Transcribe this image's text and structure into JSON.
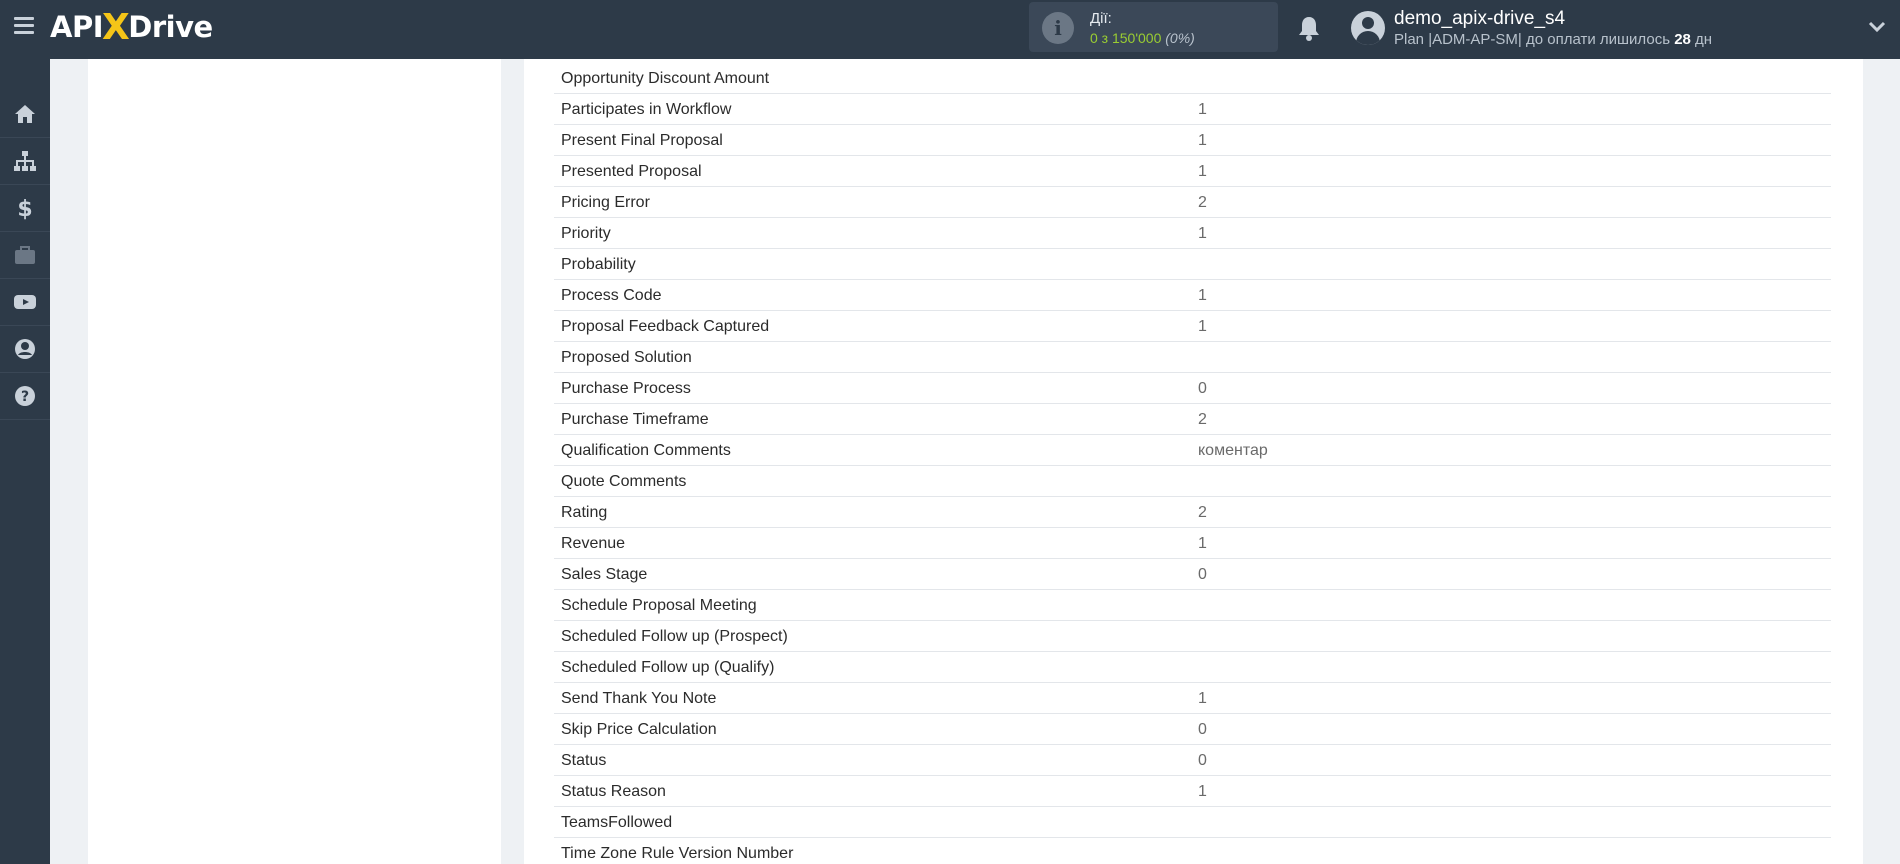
{
  "header": {
    "logo": {
      "api": "API",
      "x": "X",
      "drive": "Drive"
    },
    "stats": {
      "label": "Дії:",
      "value": "0 з 150'000",
      "percent": "(0%)"
    },
    "user": {
      "name": "demo_apix-drive_s4",
      "plan_prefix": "Plan |ADM-AP-SM| до оплати лишилось ",
      "days": "28",
      "days_suffix": " дн"
    }
  },
  "sidebar": {
    "items": [
      {
        "name": "home",
        "icon": "home-icon"
      },
      {
        "name": "connections",
        "icon": "sitemap-icon"
      },
      {
        "name": "billing",
        "icon": "dollar-icon"
      },
      {
        "name": "services",
        "icon": "briefcase-icon"
      },
      {
        "name": "video",
        "icon": "youtube-icon"
      },
      {
        "name": "account",
        "icon": "user-circle-icon"
      },
      {
        "name": "help",
        "icon": "question-circle-icon"
      }
    ]
  },
  "fields": [
    {
      "label": "Opportunity Discount Amount",
      "value": ""
    },
    {
      "label": "Participates in Workflow",
      "value": "1"
    },
    {
      "label": "Present Final Proposal",
      "value": "1"
    },
    {
      "label": "Presented Proposal",
      "value": "1"
    },
    {
      "label": "Pricing Error",
      "value": "2"
    },
    {
      "label": "Priority",
      "value": "1"
    },
    {
      "label": "Probability",
      "value": ""
    },
    {
      "label": "Process Code",
      "value": "1"
    },
    {
      "label": "Proposal Feedback Captured",
      "value": "1"
    },
    {
      "label": "Proposed Solution",
      "value": ""
    },
    {
      "label": "Purchase Process",
      "value": "0"
    },
    {
      "label": "Purchase Timeframe",
      "value": "2"
    },
    {
      "label": "Qualification Comments",
      "value": "коментар"
    },
    {
      "label": "Quote Comments",
      "value": ""
    },
    {
      "label": "Rating",
      "value": "2"
    },
    {
      "label": "Revenue",
      "value": "1"
    },
    {
      "label": "Sales Stage",
      "value": "0"
    },
    {
      "label": "Schedule Proposal Meeting",
      "value": ""
    },
    {
      "label": "Scheduled Follow up (Prospect)",
      "value": ""
    },
    {
      "label": "Scheduled Follow up (Qualify)",
      "value": ""
    },
    {
      "label": "Send Thank You Note",
      "value": "1"
    },
    {
      "label": "Skip Price Calculation",
      "value": "0"
    },
    {
      "label": "Status",
      "value": "0"
    },
    {
      "label": "Status Reason",
      "value": "1"
    },
    {
      "label": "TeamsFollowed",
      "value": ""
    },
    {
      "label": "Time Zone Rule Version Number",
      "value": ""
    }
  ]
}
